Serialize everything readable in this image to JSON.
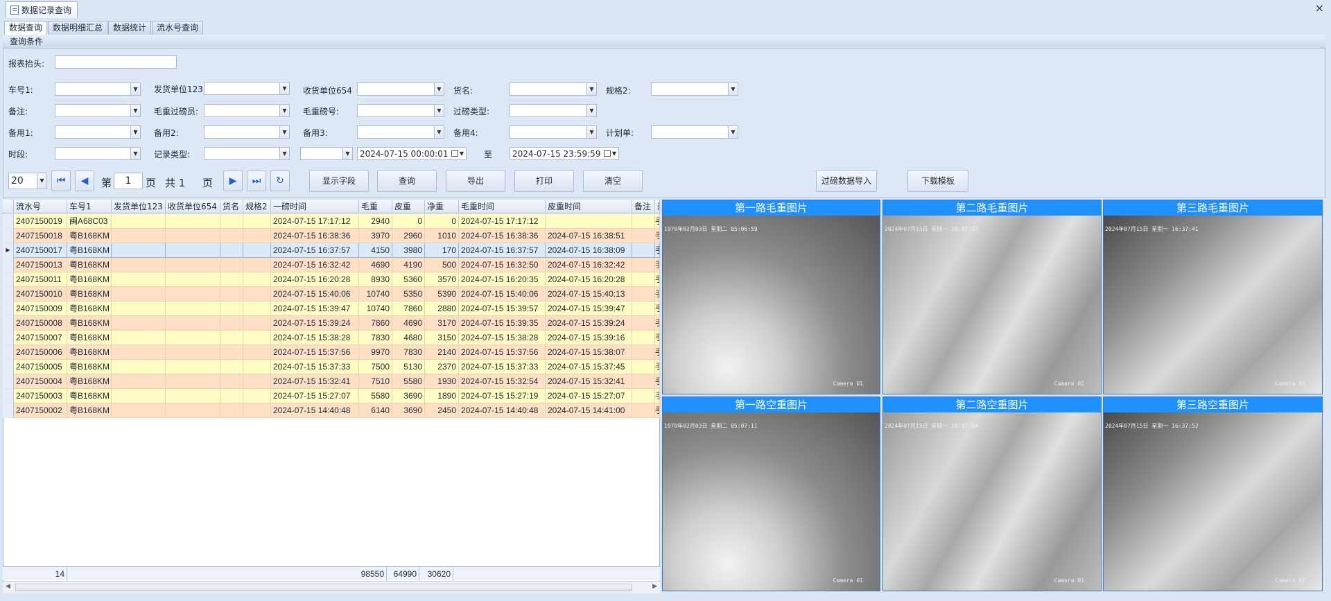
{
  "window": {
    "tab_title": "数据记录查询",
    "close": "×"
  },
  "subtabs": [
    "数据查询",
    "数据明细汇总",
    "数据统计",
    "流水号查询"
  ],
  "panel": {
    "title": "查询条件",
    "report_header_label": "报表抬头:",
    "labels": {
      "plate": "车号1:",
      "sender": "发货单位123",
      "receiver": "收货单位654",
      "goods": "货名:",
      "spec2": "规格2:",
      "remark": "备注:",
      "gross_operator": "毛重过磅员:",
      "gross_scale": "毛重磅号:",
      "weigh_type": "过磅类型:",
      "spare1": "备用1:",
      "spare2": "备用2:",
      "spare3": "备用3:",
      "spare4": "备用4:",
      "plan": "计划单:",
      "period": "时段:",
      "record_type": "记录类型:",
      "to": "至"
    },
    "date_from": "2024-07-15 00:00:01",
    "date_to": "2024-07-15 23:59:59",
    "pager": {
      "page_size": "20",
      "di": "第",
      "page": "1",
      "ye": "页",
      "gong": "共 1",
      "ye2": "页"
    },
    "buttons": {
      "show_fields": "显示字段",
      "query": "查询",
      "export": "导出",
      "print": "打印",
      "clear": "清空",
      "import": "过磅数据导入",
      "download": "下载模板"
    }
  },
  "grid": {
    "columns": [
      "流水号",
      "车号1",
      "发货单位123",
      "收货单位654",
      "货名",
      "规格2",
      "一磅时间",
      "毛重",
      "皮重",
      "净重",
      "毛重时间",
      "皮重时间",
      "备注",
      "过"
    ],
    "rows": [
      [
        "2407150019",
        "闽A68C03",
        "",
        "",
        "",
        "",
        "2024-07-15 17:17:12",
        "2940",
        "0",
        "0",
        "2024-07-15 17:17:12",
        "",
        "",
        "手"
      ],
      [
        "2407150018",
        "粤B168KM",
        "",
        "",
        "",
        "",
        "2024-07-15 16:38:36",
        "3970",
        "2960",
        "1010",
        "2024-07-15 16:38:36",
        "2024-07-15 16:38:51",
        "",
        "手"
      ],
      [
        "2407150017",
        "粤B168KM",
        "",
        "",
        "",
        "",
        "2024-07-15 16:37:57",
        "4150",
        "3980",
        "170",
        "2024-07-15 16:37:57",
        "2024-07-15 16:38:09",
        "",
        "手"
      ],
      [
        "2407150013",
        "粤B168KM",
        "",
        "",
        "",
        "",
        "2024-07-15 16:32:42",
        "4690",
        "4190",
        "500",
        "2024-07-15 16:32:50",
        "2024-07-15 16:32:42",
        "",
        "手"
      ],
      [
        "2407150011",
        "粤B168KM",
        "",
        "",
        "",
        "",
        "2024-07-15 16:20:28",
        "8930",
        "5360",
        "3570",
        "2024-07-15 16:20:35",
        "2024-07-15 16:20:28",
        "",
        "手"
      ],
      [
        "2407150010",
        "粤B168KM",
        "",
        "",
        "",
        "",
        "2024-07-15 15:40:06",
        "10740",
        "5350",
        "5390",
        "2024-07-15 15:40:06",
        "2024-07-15 15:40:13",
        "",
        "手"
      ],
      [
        "2407150009",
        "粤B168KM",
        "",
        "",
        "",
        "",
        "2024-07-15 15:39:47",
        "10740",
        "7860",
        "2880",
        "2024-07-15 15:39:57",
        "2024-07-15 15:39:47",
        "",
        "手"
      ],
      [
        "2407150008",
        "粤B168KM",
        "",
        "",
        "",
        "",
        "2024-07-15 15:39:24",
        "7860",
        "4690",
        "3170",
        "2024-07-15 15:39:35",
        "2024-07-15 15:39:24",
        "",
        "手"
      ],
      [
        "2407150007",
        "粤B168KM",
        "",
        "",
        "",
        "",
        "2024-07-15 15:38:28",
        "7830",
        "4680",
        "3150",
        "2024-07-15 15:38:28",
        "2024-07-15 15:39:16",
        "",
        "手"
      ],
      [
        "2407150006",
        "粤B168KM",
        "",
        "",
        "",
        "",
        "2024-07-15 15:37:56",
        "9970",
        "7830",
        "2140",
        "2024-07-15 15:37:56",
        "2024-07-15 15:38:07",
        "",
        "手"
      ],
      [
        "2407150005",
        "粤B168KM",
        "",
        "",
        "",
        "",
        "2024-07-15 15:37:33",
        "7500",
        "5130",
        "2370",
        "2024-07-15 15:37:33",
        "2024-07-15 15:37:45",
        "",
        "手"
      ],
      [
        "2407150004",
        "粤B168KM",
        "",
        "",
        "",
        "",
        "2024-07-15 15:32:41",
        "7510",
        "5580",
        "1930",
        "2024-07-15 15:32:54",
        "2024-07-15 15:32:41",
        "",
        "手"
      ],
      [
        "2407150003",
        "粤B168KM",
        "",
        "",
        "",
        "",
        "2024-07-15 15:27:07",
        "5580",
        "3690",
        "1890",
        "2024-07-15 15:27:19",
        "2024-07-15 15:27:07",
        "",
        "手"
      ],
      [
        "2407150002",
        "粤B168KM",
        "",
        "",
        "",
        "",
        "2024-07-15 14:40:48",
        "6140",
        "3690",
        "2450",
        "2024-07-15 14:40:48",
        "2024-07-15 14:41:00",
        "",
        "手"
      ]
    ],
    "footer": {
      "count": "14",
      "gross_sum": "98550",
      "tare_sum": "64990",
      "net_sum": "30620"
    }
  },
  "cameras": [
    {
      "title": "第一路毛重图片",
      "timestamp": "1970年02月03日 星期二 05:06:59",
      "label": "Camera 01"
    },
    {
      "title": "第二路毛重图片",
      "timestamp": "2024年07月15日 星期一 16:37:42",
      "label": "Camera 01"
    },
    {
      "title": "第三路毛重图片",
      "timestamp": "2024年07月15日 星期一 16:37:41",
      "label": "Camera 01"
    },
    {
      "title": "第一路空重图片",
      "timestamp": "1970年02月03日 星期二 05:07:11",
      "label": "Camera 01"
    },
    {
      "title": "第二路空重图片",
      "timestamp": "2024年07月15日 星期一 16:37:54",
      "label": "Camera 01"
    },
    {
      "title": "第三路空重图片",
      "timestamp": "2024年07月15日 星期一 16:37:52",
      "label": "Camera 01"
    }
  ]
}
